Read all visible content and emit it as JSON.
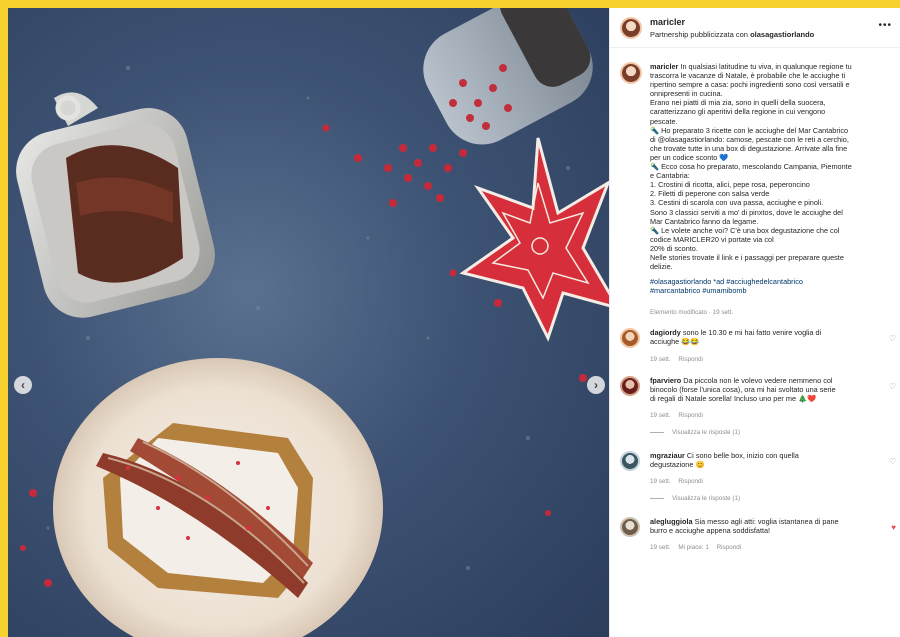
{
  "colors": {
    "page_border": "#f7d22e",
    "text": "#262626",
    "secondary": "#8e8e8e",
    "link": "#00376b",
    "like": "#ed4956"
  },
  "post": {
    "username": "maricler",
    "partnership_prefix": "Partnership pubblicizzata con",
    "partner": "olasagastiorlando",
    "more_icon": "•••",
    "caption_user": "maricler",
    "caption_text": " In qualsiasi latitudine tu viva, in qualunque regione tu\ntrascorra le vacanze di Natale, è probabile che le acciughe ti\nripertino sempre a casa: pochi ingredienti sono così versatili e\nonnipresenti in cucina.\nErano nei piatti di mia zia, sono in quelli della suocera,\ncaratterizzano gli aperitivi della regione in cui vengono\npescate.\n🔦 Ho preparato 3 ricette con le acciughe del Mar Cantabrico\ndi @olasagastiorlando: camose, pescate con le reti a cerchio,\nche trovate tutte in una box di degustazione. Arrivate alla fine\nper un codice sconto 💙\n🔦 Ecco cosa ho preparato, mescolando Campania, Piemonte\ne Cantabria:\n1. Crostini di ricotta, alici, pepe rosa, peperoncino\n2. Filetti di peperone con salsa verde\n3. Cestini di scarola con uva passa, acciughe e pinoli.\nSono 3 classici serviti a mo' di pinxtos, dove le acciughe del\nMar Cantabrico fanno da legame.\n🔦 Le volete anche voi? C'è una box degustazione che col\ncodice MARICLER20 vi portate via col\n20% di sconto.\nNelle stories trovate il link e i passaggi per preparare queste\ndelizie.",
    "hashtags": "#olasagastiorlando *ad #acciughedelcantabrico\n#marcantabrico #umamibomb",
    "edited": "Elemento modificato · 19 sett."
  },
  "comments": [
    {
      "user": "dagiordy",
      "text": " sono le 10.30 e mi hai fatto venire voglia di\nacciughe 😂😂",
      "meta_time": "19 sett.",
      "meta_reply": "Rispondi",
      "view_replies": ""
    },
    {
      "user": "fparviero",
      "text": " Da piccola non le volevo vedere nemmeno col\nbinocolo (forse l'unica cosa), ora mi hai svoltato una serie\ndi regali di Natale sorella! Incluso uno per me 🎄❤️",
      "meta_time": "19 sett.",
      "meta_reply": "Rispondi",
      "view_replies": "Visualizza le risposte (1)"
    },
    {
      "user": "mgraziaur",
      "text": " Ci sono belle box, inizio con quella\ndegustazione 😊",
      "meta_time": "19 sett.",
      "meta_reply": "Rispondi",
      "view_replies": "Visualizza le risposte (1)"
    },
    {
      "user": "alegluggiola",
      "text": " Sia messo agli atti: voglia istantanea di pane\nburro e acciughe appena soddisfatta!",
      "meta_time": "19 sett.",
      "meta_likes": "Mi piace: 1",
      "meta_reply": "Rispondi"
    }
  ],
  "icons": {
    "heart": "♡",
    "heart_liked": "♥",
    "prev": "‹",
    "next": "›"
  }
}
